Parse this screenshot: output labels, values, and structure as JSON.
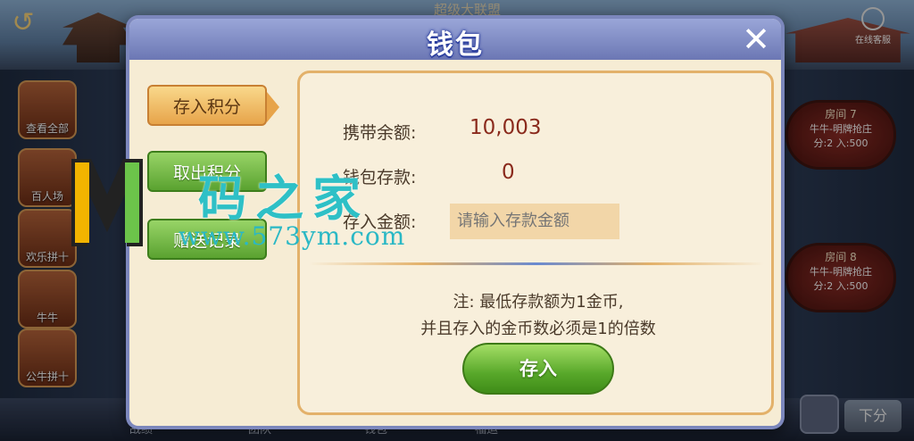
{
  "background": {
    "title": "超级大联盟",
    "online_service": "在线客服",
    "sidebar": [
      {
        "label": "查看全部"
      },
      {
        "label": "百人场"
      },
      {
        "label": "欢乐拼十"
      },
      {
        "label": "牛牛"
      },
      {
        "label": "公牛拼十"
      }
    ],
    "rooms": [
      {
        "name": "房间 7",
        "game": "牛牛-明牌抢庄",
        "info": "分:2   入:500"
      },
      {
        "name": "房间 8",
        "game": "牛牛-明牌抢庄",
        "info": "分:2   入:500"
      }
    ],
    "bottom": {
      "item1": "战绩",
      "item2": "团队",
      "item3": "钱包",
      "item4": "福运",
      "next": "下分"
    }
  },
  "modal": {
    "title": "钱包",
    "close": "✕",
    "tabs": [
      "存入积分",
      "取出积分",
      "赠送记录"
    ],
    "panel": {
      "balance_label": "携带余额:",
      "balance_value": "10,003",
      "deposit_label": "钱包存款:",
      "deposit_value": "0",
      "amount_label": "存入金额:",
      "amount_placeholder": "请输入存款金额",
      "note_line1": "注: 最低存款额为1金币,",
      "note_line2": "并且存入的金币数必须是1的倍数",
      "confirm": "存入"
    }
  },
  "watermark": {
    "text": "码之家",
    "url": "www.573ym.com"
  },
  "colors": {
    "accent_orange": "#e7a44a",
    "green_button": "#58a82a",
    "value_red": "#8a2a1c",
    "modal_frame": "#7c87bc"
  }
}
